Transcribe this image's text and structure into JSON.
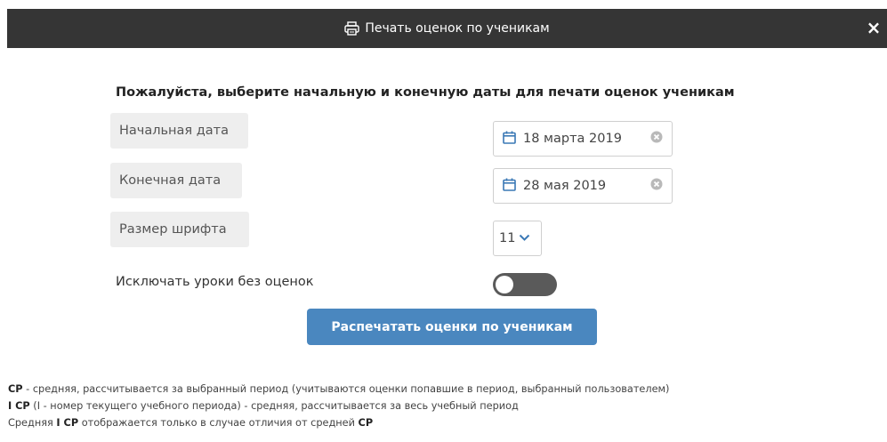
{
  "header": {
    "title": "Печать оценок по ученикам",
    "close_symbol": "×",
    "icon": "printer-icon"
  },
  "instruction": "Пожалуйста, выберите начальную и конечную даты для печати оценок ученикам",
  "fields": {
    "start": {
      "label": "Начальная дата",
      "value": "18 марта 2019"
    },
    "end": {
      "label": "Конечная дата",
      "value": "28 мая 2019"
    },
    "font_size": {
      "label": "Размер шрифта",
      "value": "11"
    }
  },
  "exclude_toggle": {
    "label": "Исключать уроки без оценок",
    "checked": false
  },
  "print_button": "Распечатать оценки по ученикам",
  "notes": {
    "line1": {
      "term": "СР",
      "text": " - средняя, рассчитывается за выбранный период (учитываются оценки попавшие в период, выбранный пользователем)"
    },
    "line2": {
      "term": "I СР",
      "text": " (I - номер текущего учебного периода) - средняя, рассчитывается за весь учебный период"
    },
    "line3": {
      "prefix": "Средняя ",
      "term": "I СР",
      "middle": " отображается только в случае отличия от средней ",
      "term2": "СР"
    }
  },
  "colors": {
    "header_bg": "#353535",
    "button_bg": "#4a87bf",
    "calendar_icon": "#3a78b5",
    "toggle_off": "#5a5a5a"
  }
}
